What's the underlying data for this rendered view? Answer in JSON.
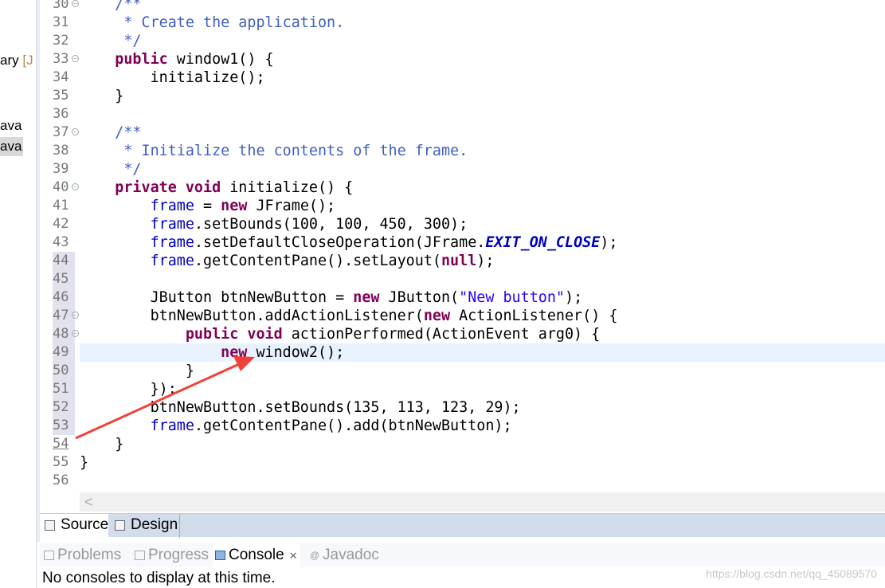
{
  "explorer": {
    "items": [
      {
        "label": "ary",
        "suffix": "[J"
      },
      {
        "label": "ava"
      },
      {
        "label": "ava",
        "selected": true
      }
    ]
  },
  "editor": {
    "highlight_line": 49,
    "folds": [
      30,
      33,
      37,
      40,
      47,
      48
    ],
    "lines": [
      {
        "n": 30,
        "t": [
          [
            "cm",
            "    /**"
          ]
        ]
      },
      {
        "n": 31,
        "t": [
          [
            "cm",
            "     * Create the application."
          ]
        ]
      },
      {
        "n": 32,
        "t": [
          [
            "cm",
            "     */"
          ]
        ]
      },
      {
        "n": 33,
        "t": [
          [
            "kw",
            "    public "
          ],
          [
            "",
            "window1() {"
          ]
        ]
      },
      {
        "n": 34,
        "t": [
          [
            "",
            "        initialize();"
          ]
        ]
      },
      {
        "n": 35,
        "t": [
          [
            "",
            "    }"
          ]
        ]
      },
      {
        "n": 36,
        "t": []
      },
      {
        "n": 37,
        "t": [
          [
            "cm",
            "    /**"
          ]
        ]
      },
      {
        "n": 38,
        "t": [
          [
            "cm",
            "     * Initialize the contents of the frame."
          ]
        ]
      },
      {
        "n": 39,
        "t": [
          [
            "cm",
            "     */"
          ]
        ]
      },
      {
        "n": 40,
        "t": [
          [
            "kw",
            "    private void "
          ],
          [
            "",
            "initialize() {"
          ]
        ]
      },
      {
        "n": 41,
        "t": [
          [
            "",
            "        "
          ],
          [
            "fld",
            "frame"
          ],
          [
            "",
            " = "
          ],
          [
            "kw",
            "new "
          ],
          [
            "",
            "JFrame();"
          ]
        ]
      },
      {
        "n": 42,
        "t": [
          [
            "",
            "        "
          ],
          [
            "fld",
            "frame"
          ],
          [
            "",
            ".setBounds(100, 100, 450, 300);"
          ]
        ]
      },
      {
        "n": 43,
        "t": [
          [
            "",
            "        "
          ],
          [
            "fld",
            "frame"
          ],
          [
            "",
            ".setDefaultCloseOperation(JFrame."
          ],
          [
            "sfld",
            "EXIT_ON_CLOSE"
          ],
          [
            "",
            ");"
          ]
        ]
      },
      {
        "n": 44,
        "t": [
          [
            "",
            "        "
          ],
          [
            "fld",
            "frame"
          ],
          [
            "",
            ".getContentPane().setLayout("
          ],
          [
            "kw",
            "null"
          ],
          [
            "",
            ");"
          ]
        ]
      },
      {
        "n": 45,
        "t": []
      },
      {
        "n": 46,
        "t": [
          [
            "",
            "        JButton btnNewButton = "
          ],
          [
            "kw",
            "new "
          ],
          [
            "",
            "JButton("
          ],
          [
            "str",
            "\"New button\""
          ],
          [
            "",
            ");"
          ]
        ]
      },
      {
        "n": 47,
        "t": [
          [
            "",
            "        btnNewButton.addActionListener("
          ],
          [
            "kw",
            "new "
          ],
          [
            "",
            "ActionListener() {"
          ]
        ]
      },
      {
        "n": 48,
        "t": [
          [
            "kw",
            "            public void "
          ],
          [
            "",
            "actionPerformed(ActionEvent arg0) {"
          ]
        ]
      },
      {
        "n": 49,
        "t": [
          [
            "kw",
            "                new "
          ],
          [
            "",
            "window2();"
          ]
        ]
      },
      {
        "n": 50,
        "t": [
          [
            "",
            "            }"
          ]
        ]
      },
      {
        "n": 51,
        "t": [
          [
            "",
            "        });"
          ]
        ]
      },
      {
        "n": 52,
        "t": [
          [
            "",
            "        btnNewButton.setBounds(135, 113, 123, 29);"
          ]
        ]
      },
      {
        "n": 53,
        "t": [
          [
            "",
            "        "
          ],
          [
            "fld",
            "frame"
          ],
          [
            "",
            ".getContentPane().add(btnNewButton);"
          ]
        ]
      },
      {
        "n": 54,
        "t": [
          [
            "",
            "    }"
          ]
        ]
      },
      {
        "n": 55,
        "t": [
          [
            "",
            "}"
          ]
        ]
      },
      {
        "n": 56,
        "t": []
      }
    ],
    "changed_lines": [
      44,
      45,
      46,
      47,
      48,
      49,
      50,
      51,
      52,
      53
    ],
    "scroll_left_icon": "chevron-left-icon",
    "scroll_left_glyph": "<"
  },
  "editor_tabs": {
    "source": "Source",
    "design": "Design"
  },
  "console": {
    "tabs": {
      "problems": "Problems",
      "progress": "Progress",
      "console": "Console",
      "javadoc": "Javadoc"
    },
    "close_glyph": "✕",
    "javadoc_glyph": "@",
    "message": "No consoles to display at this time."
  },
  "watermark": "https://blog.csdn.net/qq_45089570",
  "annotation": {
    "color": "#f0413a",
    "from_line": 54,
    "to_line": 49
  }
}
